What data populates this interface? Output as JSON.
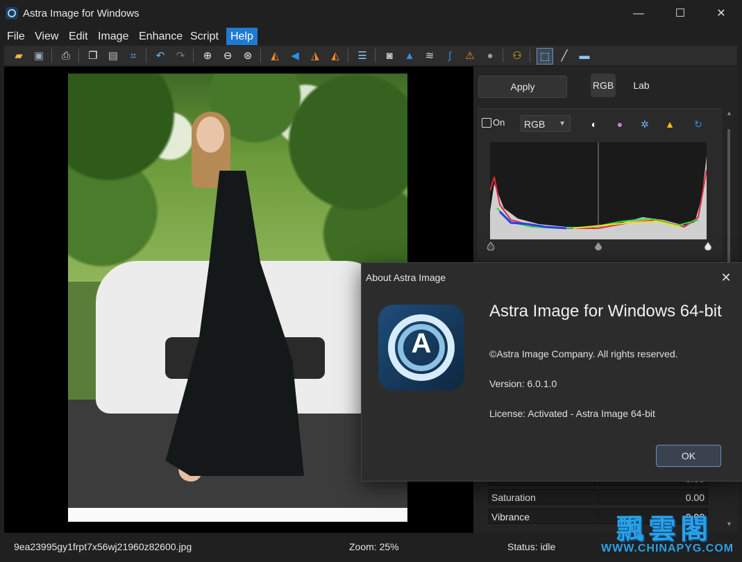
{
  "window": {
    "title": "Astra Image for Windows",
    "minimize": "—",
    "maximize": "☐",
    "close": "✕"
  },
  "menu": [
    "File",
    "View",
    "Edit",
    "Image",
    "Enhance",
    "Script",
    "Help"
  ],
  "panel": {
    "apply_label": "Apply",
    "tab_rgb": "RGB",
    "tab_lab": "Lab",
    "on_label": "On",
    "channel_select": "RGB",
    "adjustments": [
      {
        "label": "Saturation",
        "value": "0.00"
      },
      {
        "label": "Vibrance",
        "value": "0.00"
      }
    ],
    "partial_row_value": "0.00"
  },
  "status": {
    "filename": "9ea23995gy1frpt7x56wj21960z82600.jpg",
    "zoom": "Zoom: 25%",
    "state": "Status: idle"
  },
  "dialog": {
    "title": "About Astra Image",
    "close": "✕",
    "logo_letter": "A",
    "heading": "Astra Image for Windows 64-bit",
    "copyright": "©Astra Image Company. All rights reserved.",
    "version": "Version: 6.0.1.0",
    "license": "License:  Activated - Astra Image 64-bit",
    "ok_label": "OK"
  },
  "watermark": {
    "chinese": "飄雲閣",
    "url": "WWW.CHINAPYG.COM"
  },
  "colors": {
    "accent": "#1f7ad1",
    "background": "#202020",
    "panel": "#242424",
    "dialog": "#2c2c2c"
  }
}
